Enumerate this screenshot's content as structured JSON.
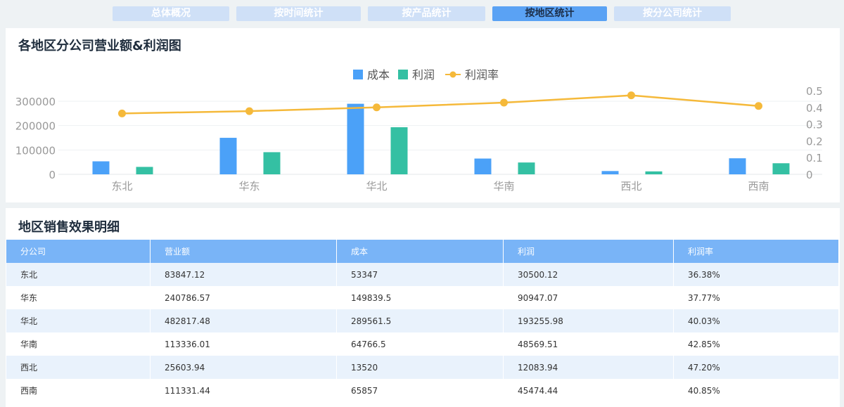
{
  "tabs": [
    {
      "label": "总体概况",
      "active": false
    },
    {
      "label": "按时间统计",
      "active": false
    },
    {
      "label": "按产品统计",
      "active": false
    },
    {
      "label": "按地区统计",
      "active": true
    },
    {
      "label": "按分公司统计",
      "active": false
    }
  ],
  "chart_panel": {
    "title": "各地区分公司营业额&利润图"
  },
  "table_panel": {
    "title": "地区销售效果明细"
  },
  "colors": {
    "cost": "#4ba1f8",
    "profit": "#34c0a3",
    "rate": "#f5b93a",
    "header": "#79b4f7"
  },
  "chart_data": {
    "type": "bar",
    "categories": [
      "东北",
      "华东",
      "华北",
      "华南",
      "西北",
      "西南"
    ],
    "series": [
      {
        "name": "成本",
        "type": "bar",
        "axis": "left",
        "values": [
          53347,
          149839.5,
          289561.5,
          64766.5,
          13520,
          65857
        ]
      },
      {
        "name": "利润",
        "type": "bar",
        "axis": "left",
        "values": [
          30500.12,
          90947.07,
          193255.98,
          48569.51,
          12083.94,
          45474.44
        ]
      },
      {
        "name": "利润率",
        "type": "line",
        "axis": "right",
        "values": [
          0.3638,
          0.3777,
          0.4003,
          0.4285,
          0.472,
          0.4085
        ]
      }
    ],
    "y_left": {
      "ticks": [
        "0",
        "100000",
        "200000",
        "300000"
      ],
      "range": [
        0,
        300000
      ]
    },
    "y_right": {
      "ticks": [
        "0",
        "0.1",
        "0.2",
        "0.3",
        "0.4",
        "0.5"
      ],
      "range": [
        0,
        0.5
      ]
    },
    "legend": {
      "position": "top-center",
      "items": [
        "成本",
        "利润",
        "利润率"
      ]
    },
    "grid": true
  },
  "table": {
    "headers": [
      "分公司",
      "营业额",
      "成本",
      "利润",
      "利润率"
    ],
    "rows": [
      [
        "东北",
        "83847.12",
        "53347",
        "30500.12",
        "36.38%"
      ],
      [
        "华东",
        "240786.57",
        "149839.5",
        "90947.07",
        "37.77%"
      ],
      [
        "华北",
        "482817.48",
        "289561.5",
        "193255.98",
        "40.03%"
      ],
      [
        "华南",
        "113336.01",
        "64766.5",
        "48569.51",
        "42.85%"
      ],
      [
        "西北",
        "25603.94",
        "13520",
        "12083.94",
        "47.20%"
      ],
      [
        "西南",
        "111331.44",
        "65857",
        "45474.44",
        "40.85%"
      ]
    ]
  }
}
